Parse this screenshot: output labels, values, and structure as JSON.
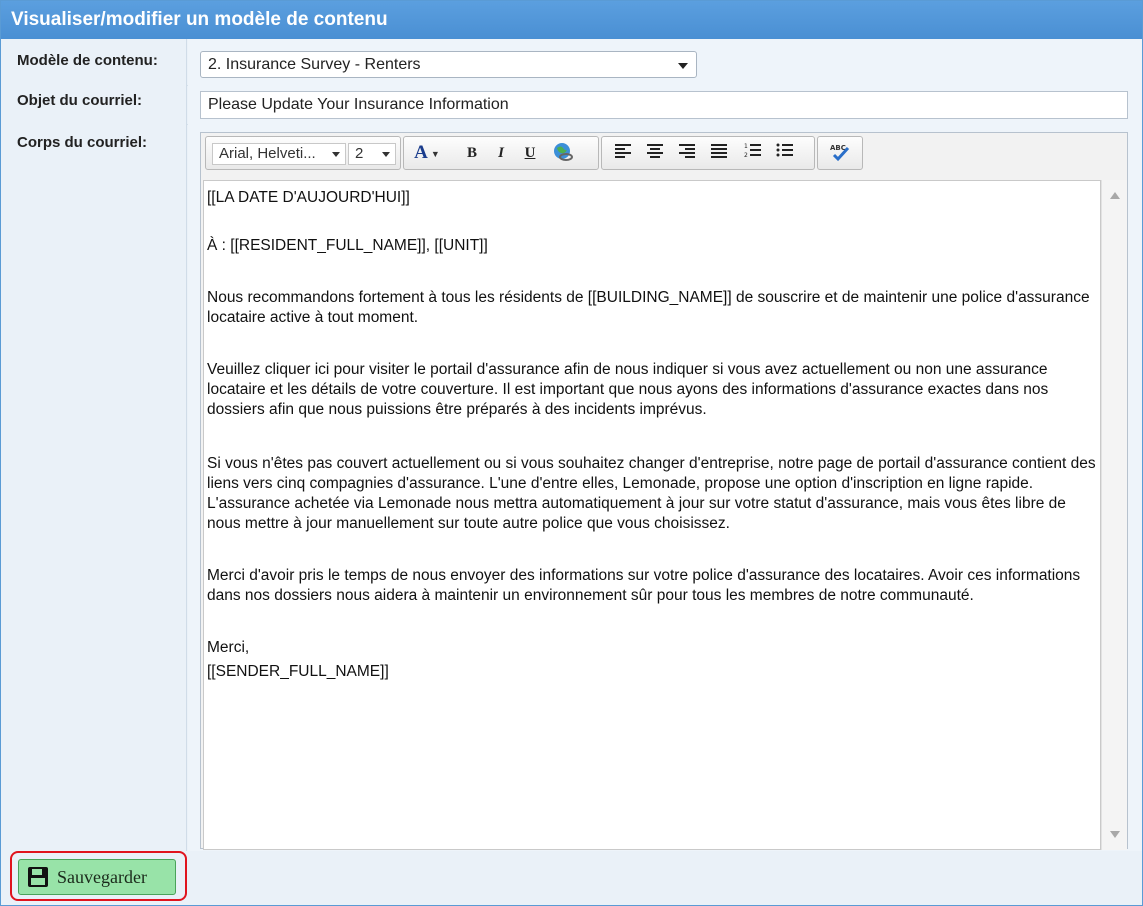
{
  "panel": {
    "title": "Visualiser/modifier un modèle de contenu"
  },
  "form": {
    "template_label": "Modèle de contenu:",
    "template_value": "2. Insurance Survey - Renters",
    "subject_label": "Objet du courriel:",
    "subject_value": "Please Update Your Insurance Information",
    "body_label": "Corps du courriel:"
  },
  "toolbar": {
    "font_family": "Arial, Helveti...",
    "font_size": "2",
    "bold": "B",
    "italic": "I",
    "underline": "U",
    "font_color": "A"
  },
  "body": {
    "paragraphs": [
      "[[LA DATE D'AUJOURD'HUI]]",
      "À : [[RESIDENT_FULL_NAME]], [[UNIT]]",
      "Nous recommandons fortement à tous les résidents de [[BUILDING_NAME]] de souscrire et de maintenir une police d'assurance locataire active à tout moment.",
      "Veuillez cliquer ici pour visiter le portail d'assurance afin de nous indiquer si vous avez actuellement ou non une assurance locataire et les détails de votre couverture. Il est important que nous ayons des informations d'assurance exactes dans nos dossiers afin que nous puissions être préparés à des incidents imprévus.",
      "Si vous n'êtes pas couvert actuellement ou si vous souhaitez changer d'entreprise, notre page de portail d'assurance contient des liens vers cinq compagnies d'assurance. L'une d'entre elles, Lemonade, propose une option d'inscription en ligne rapide. L'assurance achetée via Lemonade nous mettra automatiquement à jour sur votre statut d'assurance, mais vous êtes libre de nous mettre à jour manuellement sur toute autre police que vous choisissez.",
      "Merci d'avoir pris le temps de nous envoyer des informations sur votre police d'assurance des locataires. Avoir ces informations dans nos dossiers nous aidera à maintenir un environnement sûr pour tous les membres de notre communauté.",
      "Merci,",
      "[[SENDER_FULL_NAME]]"
    ]
  },
  "footer": {
    "save_label": "Sauvegarder"
  },
  "colors": {
    "titlebar": "#4a8fd3",
    "save_bg": "#98e3a8",
    "highlight": "#e0141e"
  }
}
